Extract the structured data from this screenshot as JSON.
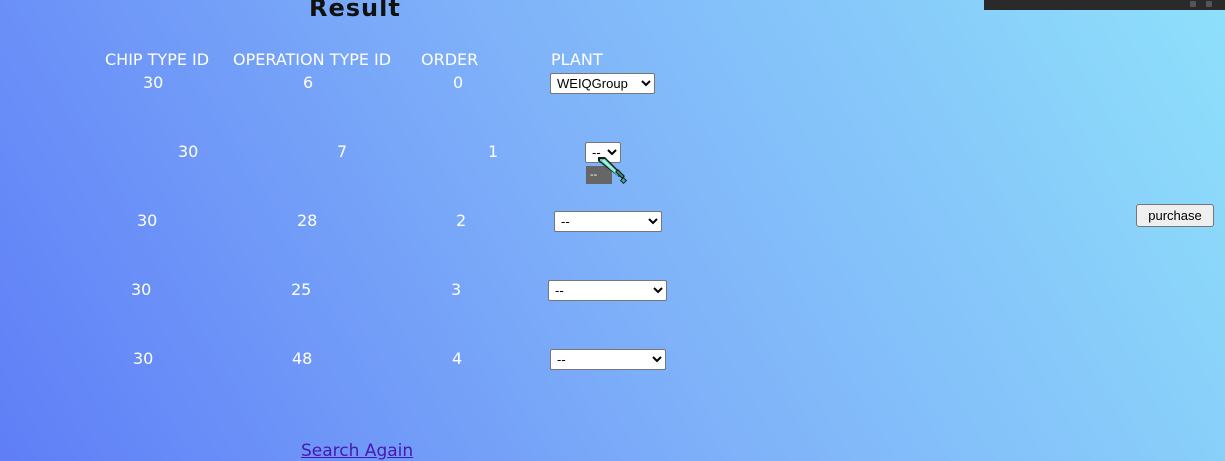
{
  "title": "Result",
  "headers": {
    "chip_type_id": "CHIP TYPE ID",
    "operation_type_id": "OPERATION TYPE ID",
    "order": "ORDER",
    "plant": "PLANT"
  },
  "rows": [
    {
      "chip": "30",
      "op": "6",
      "order": "0",
      "plant": "WEIQGroup"
    },
    {
      "chip": "30",
      "op": "7",
      "order": "1",
      "plant": "--"
    },
    {
      "chip": "30",
      "op": "28",
      "order": "2",
      "plant": "--"
    },
    {
      "chip": "30",
      "op": "25",
      "order": "3",
      "plant": "--"
    },
    {
      "chip": "30",
      "op": "48",
      "order": "4",
      "plant": "--"
    }
  ],
  "dropdown_popup": {
    "option": "--"
  },
  "cursor_icon": "sword-cursor-icon",
  "purchase_label": "purchase",
  "search_again_label": "Search Again",
  "colors": {
    "link": "#4a17b0",
    "title": "#111111"
  }
}
